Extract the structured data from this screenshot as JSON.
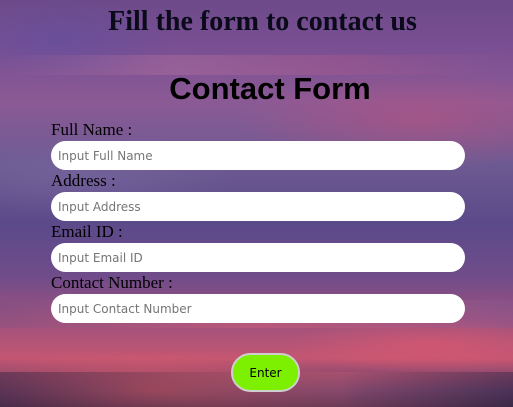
{
  "header": {
    "heading": "Fill the form to contact us"
  },
  "form": {
    "title": "Contact Form",
    "fields": [
      {
        "label": "Full Name :",
        "placeholder": "Input Full Name",
        "value": ""
      },
      {
        "label": "Address :",
        "placeholder": "Input Address",
        "value": ""
      },
      {
        "label": "Email ID :",
        "placeholder": "Input Email ID",
        "value": ""
      },
      {
        "label": "Contact Number :",
        "placeholder": "Input Contact Number",
        "value": ""
      }
    ],
    "submit_label": "Enter"
  },
  "colors": {
    "button_green": "#7cf000",
    "input_bg": "#ffffff",
    "text_dark": "#000000"
  }
}
